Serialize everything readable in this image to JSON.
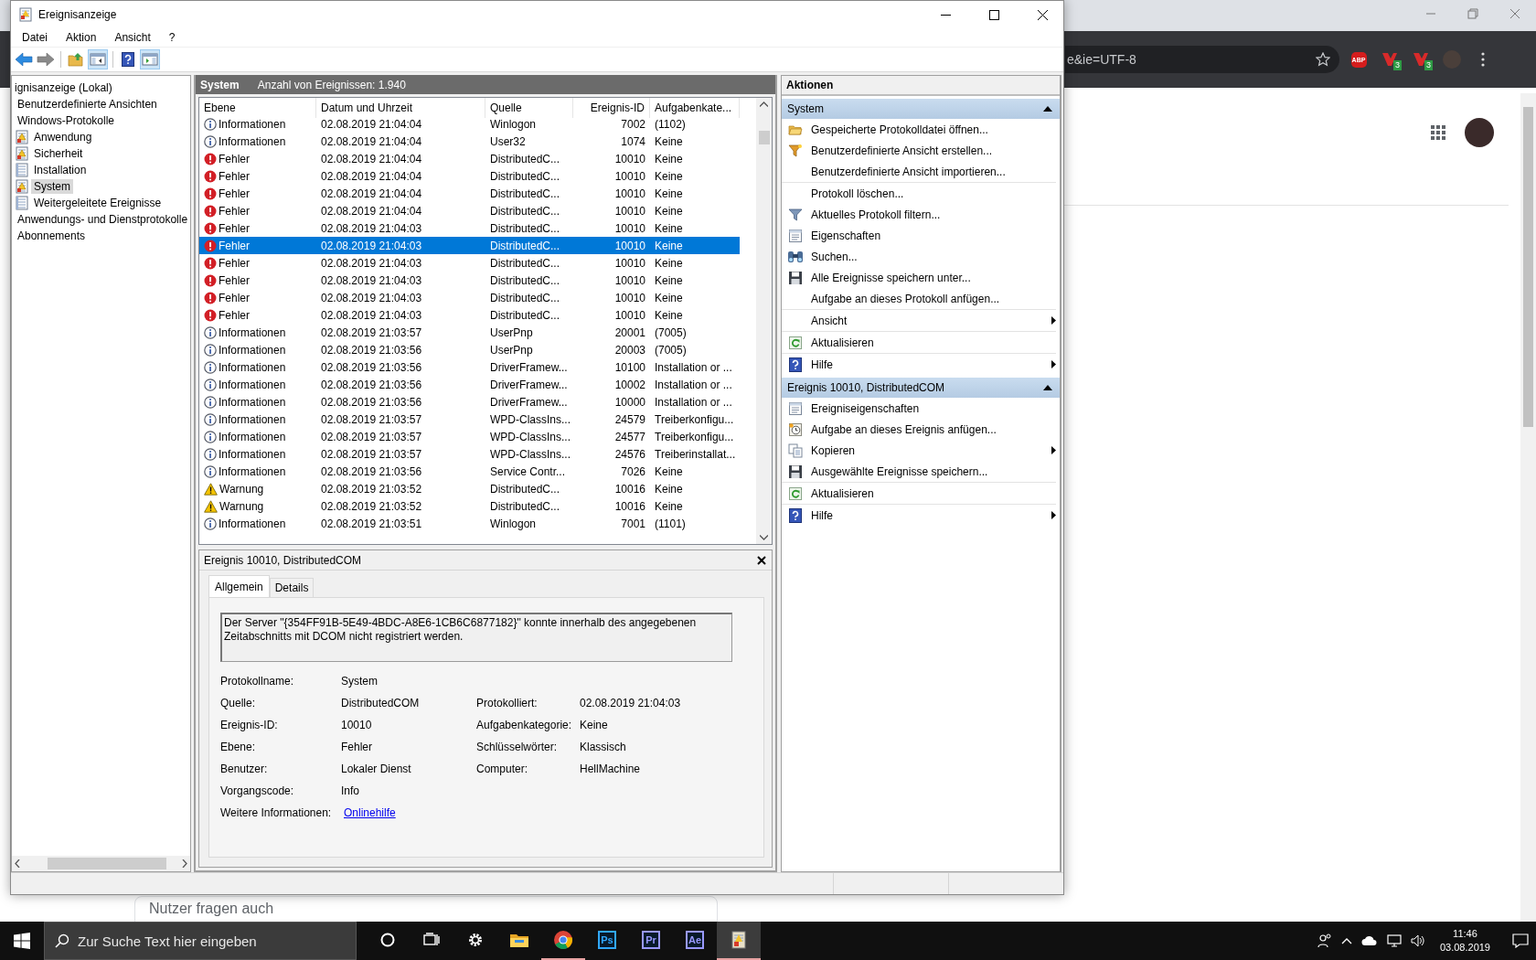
{
  "browser": {
    "address": "e&ie=UTF-8",
    "extensions": [
      {
        "kind": "abp",
        "label": "ABP"
      },
      {
        "kind": "red",
        "badge": "3"
      },
      {
        "kind": "red",
        "badge": "3"
      }
    ],
    "suggestion": "Nutzer fragen auch"
  },
  "window": {
    "title": "Ereignisanzeige"
  },
  "menu": [
    "Datei",
    "Aktion",
    "Ansicht",
    "?"
  ],
  "toolbar": [
    {
      "kind": "back",
      "on": false
    },
    {
      "kind": "forward",
      "on": false
    },
    {
      "kind": "folder-up",
      "on": false
    },
    {
      "kind": "console-tree",
      "on": true
    },
    {
      "kind": "help",
      "on": false
    },
    {
      "kind": "action-pane",
      "on": true
    }
  ],
  "tree": [
    {
      "label": "ignisanzeige (Lokal)",
      "selected": false,
      "children": [
        {
          "label": "Benutzerdefinierte Ansichten",
          "selected": false
        },
        {
          "label": "Windows-Protokolle",
          "selected": false,
          "children": [
            {
              "label": "Anwendung",
              "kind": "log-warn",
              "selected": false
            },
            {
              "label": "Sicherheit",
              "kind": "log-warn",
              "selected": false
            },
            {
              "label": "Installation",
              "kind": "log",
              "selected": false
            },
            {
              "label": "System",
              "kind": "log-warn",
              "selected": true
            },
            {
              "label": "Weitergeleitete Ereignisse",
              "kind": "log",
              "selected": false
            }
          ]
        },
        {
          "label": "Anwendungs- und Dienstprotokolle",
          "selected": false
        },
        {
          "label": "Abonnements",
          "selected": false
        }
      ]
    }
  ],
  "log_header": {
    "name": "System",
    "count": "Anzahl von Ereignissen: 1.940"
  },
  "table": {
    "columns": [
      "Ebene",
      "Datum und Uhrzeit",
      "Quelle",
      "Ereignis-ID",
      "Aufgabenkate..."
    ],
    "rows": [
      {
        "kind": "info",
        "severity": "Informationen",
        "date": "02.08.2019 21:04:04",
        "source": "Winlogon",
        "event_id": "7002",
        "task_category": "(1102)",
        "selected": false
      },
      {
        "kind": "info",
        "severity": "Informationen",
        "date": "02.08.2019 21:04:04",
        "source": "User32",
        "event_id": "1074",
        "task_category": "Keine",
        "selected": false
      },
      {
        "kind": "error",
        "severity": "Fehler",
        "date": "02.08.2019 21:04:04",
        "source": "DistributedC...",
        "event_id": "10010",
        "task_category": "Keine",
        "selected": false
      },
      {
        "kind": "error",
        "severity": "Fehler",
        "date": "02.08.2019 21:04:04",
        "source": "DistributedC...",
        "event_id": "10010",
        "task_category": "Keine",
        "selected": false
      },
      {
        "kind": "error",
        "severity": "Fehler",
        "date": "02.08.2019 21:04:04",
        "source": "DistributedC...",
        "event_id": "10010",
        "task_category": "Keine",
        "selected": false
      },
      {
        "kind": "error",
        "severity": "Fehler",
        "date": "02.08.2019 21:04:04",
        "source": "DistributedC...",
        "event_id": "10010",
        "task_category": "Keine",
        "selected": false
      },
      {
        "kind": "error",
        "severity": "Fehler",
        "date": "02.08.2019 21:04:03",
        "source": "DistributedC...",
        "event_id": "10010",
        "task_category": "Keine",
        "selected": false
      },
      {
        "kind": "error",
        "severity": "Fehler",
        "date": "02.08.2019 21:04:03",
        "source": "DistributedC...",
        "event_id": "10010",
        "task_category": "Keine",
        "selected": true
      },
      {
        "kind": "error",
        "severity": "Fehler",
        "date": "02.08.2019 21:04:03",
        "source": "DistributedC...",
        "event_id": "10010",
        "task_category": "Keine",
        "selected": false
      },
      {
        "kind": "error",
        "severity": "Fehler",
        "date": "02.08.2019 21:04:03",
        "source": "DistributedC...",
        "event_id": "10010",
        "task_category": "Keine",
        "selected": false
      },
      {
        "kind": "error",
        "severity": "Fehler",
        "date": "02.08.2019 21:04:03",
        "source": "DistributedC...",
        "event_id": "10010",
        "task_category": "Keine",
        "selected": false
      },
      {
        "kind": "error",
        "severity": "Fehler",
        "date": "02.08.2019 21:04:03",
        "source": "DistributedC...",
        "event_id": "10010",
        "task_category": "Keine",
        "selected": false
      },
      {
        "kind": "info",
        "severity": "Informationen",
        "date": "02.08.2019 21:03:57",
        "source": "UserPnp",
        "event_id": "20001",
        "task_category": "(7005)",
        "selected": false
      },
      {
        "kind": "info",
        "severity": "Informationen",
        "date": "02.08.2019 21:03:56",
        "source": "UserPnp",
        "event_id": "20003",
        "task_category": "(7005)",
        "selected": false
      },
      {
        "kind": "info",
        "severity": "Informationen",
        "date": "02.08.2019 21:03:56",
        "source": "DriverFramew...",
        "event_id": "10100",
        "task_category": "Installation or ...",
        "selected": false
      },
      {
        "kind": "info",
        "severity": "Informationen",
        "date": "02.08.2019 21:03:56",
        "source": "DriverFramew...",
        "event_id": "10002",
        "task_category": "Installation or ...",
        "selected": false
      },
      {
        "kind": "info",
        "severity": "Informationen",
        "date": "02.08.2019 21:03:56",
        "source": "DriverFramew...",
        "event_id": "10000",
        "task_category": "Installation or ...",
        "selected": false
      },
      {
        "kind": "info",
        "severity": "Informationen",
        "date": "02.08.2019 21:03:57",
        "source": "WPD-ClassIns...",
        "event_id": "24579",
        "task_category": "Treiberkonfigu...",
        "selected": false
      },
      {
        "kind": "info",
        "severity": "Informationen",
        "date": "02.08.2019 21:03:57",
        "source": "WPD-ClassIns...",
        "event_id": "24577",
        "task_category": "Treiberkonfigu...",
        "selected": false
      },
      {
        "kind": "info",
        "severity": "Informationen",
        "date": "02.08.2019 21:03:57",
        "source": "WPD-ClassIns...",
        "event_id": "24576",
        "task_category": "Treiberinstallat...",
        "selected": false
      },
      {
        "kind": "info",
        "severity": "Informationen",
        "date": "02.08.2019 21:03:56",
        "source": "Service Contr...",
        "event_id": "7026",
        "task_category": "Keine",
        "selected": false
      },
      {
        "kind": "warning",
        "severity": "Warnung",
        "date": "02.08.2019 21:03:52",
        "source": "DistributedC...",
        "event_id": "10016",
        "task_category": "Keine",
        "selected": false
      },
      {
        "kind": "warning",
        "severity": "Warnung",
        "date": "02.08.2019 21:03:52",
        "source": "DistributedC...",
        "event_id": "10016",
        "task_category": "Keine",
        "selected": false
      },
      {
        "kind": "info",
        "severity": "Informationen",
        "date": "02.08.2019 21:03:51",
        "source": "Winlogon",
        "event_id": "7001",
        "task_category": "(1101)",
        "selected": false
      }
    ]
  },
  "details": {
    "title": "Ereignis 10010, DistributedCOM",
    "tabs": [
      {
        "label": "Allgemein",
        "selected": true
      },
      {
        "label": "Details",
        "selected": false
      }
    ],
    "message": "Der Server \"{354FF91B-5E49-4BDC-A8E6-1CB6C6877182}\" konnte innerhalb des angegebenen Zeitabschnitts mit DCOM nicht registriert werden.",
    "fields": [
      {
        "label": "Protokollname:",
        "value": "System"
      },
      {
        "label": "Quelle:",
        "value": "DistributedCOM",
        "label_2": "Protokolliert:",
        "value_2": "02.08.2019 21:04:03"
      },
      {
        "label": "Ereignis-ID:",
        "value": "10010",
        "label_2": "Aufgabenkategorie:",
        "value_2": "Keine"
      },
      {
        "label": "Ebene:",
        "value": "Fehler",
        "label_2": "Schlüsselwörter:",
        "value_2": "Klassisch"
      },
      {
        "label": "Benutzer:",
        "value": "Lokaler Dienst",
        "label_2": "Computer:",
        "value_2": "HellMachine"
      },
      {
        "label": "Vorgangscode:",
        "value": "Info"
      },
      {
        "label": "Weitere Informationen:",
        "link": "Onlinehilfe"
      }
    ]
  },
  "actions": {
    "title": "Aktionen",
    "sections": [
      {
        "title": "System",
        "expanded": true,
        "items": [
          {
            "label": "Gespeicherte Protokolldatei öffnen...",
            "kind": "folder",
            "submenu": false,
            "separator_after": false
          },
          {
            "label": "Benutzerdefinierte Ansicht erstellen...",
            "kind": "funnel-star",
            "submenu": false,
            "separator_after": false
          },
          {
            "label": "Benutzerdefinierte Ansicht importieren...",
            "kind": "none",
            "submenu": false,
            "separator_after": true
          },
          {
            "label": "Protokoll löschen...",
            "kind": "none",
            "submenu": false,
            "separator_after": false
          },
          {
            "label": "Aktuelles Protokoll filtern...",
            "kind": "funnel",
            "submenu": false,
            "separator_after": false
          },
          {
            "label": "Eigenschaften",
            "kind": "properties",
            "submenu": false,
            "separator_after": false
          },
          {
            "label": "Suchen...",
            "kind": "binoculars",
            "submenu": false,
            "separator_after": false
          },
          {
            "label": "Alle Ereignisse speichern unter...",
            "kind": "save",
            "submenu": false,
            "separator_after": false
          },
          {
            "label": "Aufgabe an dieses Protokoll anfügen...",
            "kind": "none",
            "submenu": false,
            "separator_after": true
          },
          {
            "label": "Ansicht",
            "kind": "none",
            "submenu": true,
            "separator_after": true
          },
          {
            "label": "Aktualisieren",
            "kind": "refresh",
            "submenu": false,
            "separator_after": true
          },
          {
            "label": "Hilfe",
            "kind": "help",
            "submenu": true,
            "separator_after": false
          }
        ]
      },
      {
        "title": "Ereignis 10010, DistributedCOM",
        "expanded": true,
        "items": [
          {
            "label": "Ereigniseigenschaften",
            "kind": "properties",
            "submenu": false,
            "separator_after": false
          },
          {
            "label": "Aufgabe an dieses Ereignis anfügen...",
            "kind": "task",
            "submenu": false,
            "separator_after": false
          },
          {
            "label": "Kopieren",
            "kind": "copy",
            "submenu": true,
            "separator_after": false
          },
          {
            "label": "Ausgewählte Ereignisse speichern...",
            "kind": "save",
            "submenu": false,
            "separator_after": true
          },
          {
            "label": "Aktualisieren",
            "kind": "refresh",
            "submenu": false,
            "separator_after": true
          },
          {
            "label": "Hilfe",
            "kind": "help",
            "submenu": true,
            "separator_after": false
          }
        ]
      }
    ]
  },
  "taskbar": {
    "search_placeholder": "Zur Suche Text hier eingeben",
    "apps": [
      {
        "kind": "cortana",
        "active": false,
        "running": false
      },
      {
        "kind": "task-view",
        "active": false,
        "running": false
      },
      {
        "kind": "settings",
        "active": false,
        "running": false
      },
      {
        "kind": "explorer",
        "active": false,
        "running": false
      },
      {
        "kind": "chrome",
        "active": false,
        "running": true
      },
      {
        "kind": "ps",
        "label": "Ps",
        "active": false,
        "running": false
      },
      {
        "kind": "pr",
        "label": "Pr",
        "active": false,
        "running": false
      },
      {
        "kind": "ae",
        "label": "Ae",
        "active": false,
        "running": false
      },
      {
        "kind": "eventviewer",
        "active": true,
        "running": true
      }
    ],
    "time": "11:46",
    "date": "03.08.2019"
  }
}
